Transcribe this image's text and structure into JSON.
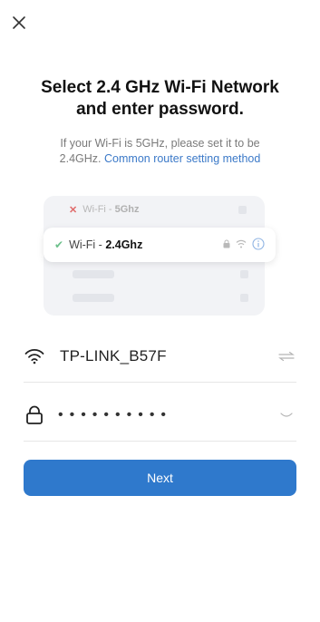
{
  "header": {
    "close_icon": "close-icon"
  },
  "title": {
    "line1": "Select 2.4 GHz Wi-Fi Network",
    "line2": "and enter password."
  },
  "subtitle": {
    "line1": "If your Wi-Fi is 5GHz, please set it to be",
    "line2_prefix": "2.4GHz.",
    "link": "Common router setting method"
  },
  "illustration": {
    "row_5g_prefix": "Wi-Fi - ",
    "row_5g_band": "5Ghz",
    "row_24g_prefix": "Wi-Fi - ",
    "row_24g_band": "2.4Ghz"
  },
  "wifi_field": {
    "ssid": "TP-LINK_B57F",
    "icon": "wifi-icon",
    "trailing_icon": "switch-icon"
  },
  "password_field": {
    "masked": "••••••••••",
    "icon": "lock-icon",
    "trailing_icon": "eye-closed-icon"
  },
  "next_button": {
    "label": "Next"
  },
  "colors": {
    "primary": "#2f79cc",
    "link": "#3b79c8",
    "check": "#6cc08b",
    "error": "#e06b6b"
  }
}
